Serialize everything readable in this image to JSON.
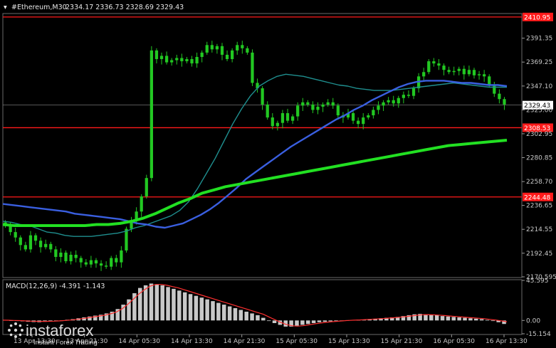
{
  "header": {
    "symbol": "#Ethereum,M30",
    "ohlc": "2334.17 2336.73 2328.69 2329.43"
  },
  "macd_header": "MACD(12,26,9) -4.391 -1.143",
  "watermark": {
    "brand": "instaforex",
    "tagline": "Instant Forex Trading"
  },
  "colors": {
    "background": "#000000",
    "candles": "#22c822",
    "ma_fast": "#1f8f8f",
    "ma_mid": "#3a5fe0",
    "ma_slow": "#22e022",
    "levels": "#ff1a1a",
    "macd_hist": "#c8c8c8",
    "macd_signal": "#ff3030"
  },
  "chart_data": [
    {
      "type": "candlestick",
      "ylim": [
        2170.595,
        2413.5
      ],
      "y_ticks": [
        "2391.35",
        "2369.25",
        "2347.10",
        "2325.00",
        "2302.95",
        "2280.85",
        "2258.70",
        "2236.65",
        "2214.55",
        "2192.45",
        "2170.595"
      ],
      "x_ticks": [
        "13 Apr 13:30",
        "13 Apr 21:30",
        "14 Apr 05:30",
        "14 Apr 13:30",
        "14 Apr 21:30",
        "15 Apr 05:30",
        "15 Apr 13:30",
        "15 Apr 21:30",
        "16 Apr 05:30",
        "16 Apr 13:30"
      ],
      "current_price": "2329.43",
      "horizontal_levels": [
        {
          "value": 2410.95,
          "label": "2410.95"
        },
        {
          "value": 2308.53,
          "label": "2308.53"
        },
        {
          "value": 2244.48,
          "label": "2244.48"
        }
      ],
      "close_series": [
        2218,
        2212,
        2207,
        2200,
        2196,
        2209,
        2204,
        2198,
        2201,
        2196,
        2189,
        2193,
        2185,
        2191,
        2188,
        2184,
        2182,
        2186,
        2183,
        2181,
        2180,
        2188,
        2184,
        2195,
        2215,
        2223,
        2231,
        2245,
        2262,
        2380,
        2372,
        2375,
        2369,
        2371,
        2373,
        2370,
        2372,
        2368,
        2374,
        2378,
        2385,
        2381,
        2384,
        2376,
        2372,
        2380,
        2385,
        2382,
        2378,
        2350,
        2345,
        2330,
        2318,
        2310,
        2313,
        2322,
        2315,
        2319,
        2329,
        2332,
        2330,
        2325,
        2328,
        2330,
        2332,
        2329,
        2320,
        2318,
        2322,
        2315,
        2312,
        2318,
        2320,
        2325,
        2329,
        2332,
        2334,
        2331,
        2336,
        2339,
        2338,
        2345,
        2356,
        2360,
        2370,
        2368,
        2366,
        2362,
        2360,
        2361,
        2363,
        2358,
        2362,
        2357,
        2358,
        2356,
        2348,
        2340,
        2335,
        2330
      ],
      "ma_fast": [
        2222,
        2221,
        2219,
        2218,
        2215,
        2212,
        2211,
        2209,
        2208,
        2208,
        2208,
        2209,
        2210,
        2211,
        2213,
        2216,
        2218,
        2221,
        2224,
        2227,
        2232,
        2240,
        2252,
        2266,
        2280,
        2296,
        2312,
        2326,
        2338,
        2347,
        2352,
        2356,
        2358,
        2357,
        2356,
        2354,
        2352,
        2350,
        2348,
        2347,
        2345,
        2344,
        2343,
        2343,
        2343,
        2344,
        2345,
        2346,
        2347,
        2348,
        2349,
        2350,
        2349,
        2348,
        2347,
        2346,
        2346,
        2346
      ],
      "ma_mid": [
        2238,
        2237,
        2236,
        2235,
        2234,
        2233,
        2232,
        2231,
        2229,
        2228,
        2227,
        2226,
        2225,
        2224,
        2222,
        2220,
        2219,
        2217,
        2216,
        2218,
        2220,
        2224,
        2228,
        2233,
        2239,
        2246,
        2253,
        2261,
        2267,
        2273,
        2279,
        2285,
        2291,
        2296,
        2301,
        2306,
        2311,
        2316,
        2320,
        2325,
        2329,
        2334,
        2338,
        2342,
        2346,
        2349,
        2351,
        2352,
        2352,
        2352,
        2351,
        2350,
        2350,
        2349,
        2348,
        2348,
        2347
      ],
      "ma_slow": [
        2219,
        2218,
        2218,
        2218,
        2218,
        2218,
        2218,
        2218,
        2219,
        2219,
        2220,
        2222,
        2225,
        2229,
        2234,
        2239,
        2243,
        2248,
        2251,
        2254,
        2256,
        2258,
        2260,
        2262,
        2264,
        2266,
        2268,
        2270,
        2272,
        2274,
        2276,
        2278,
        2280,
        2282,
        2284,
        2286,
        2288,
        2290,
        2292,
        2293,
        2294,
        2295,
        2296,
        2297
      ],
      "series": [
        {
          "name": "ma_fast"
        },
        {
          "name": "ma_mid"
        },
        {
          "name": "ma_slow"
        }
      ]
    },
    {
      "type": "bar",
      "title": "MACD(12,26,9) -4.391 -1.143",
      "ylim": [
        -15.154,
        45.595
      ],
      "y_ticks": [
        "45.595",
        "0.00",
        "-15.154"
      ],
      "histogram": [
        0.5,
        0.2,
        -0.5,
        -1,
        -1.5,
        -1.8,
        -2,
        -1.5,
        -1,
        -0.5,
        0,
        0.8,
        1.5,
        2.5,
        3.5,
        4.5,
        5.5,
        6.5,
        8,
        10,
        13,
        18,
        24,
        31,
        37,
        40,
        42,
        41,
        40,
        38,
        36,
        34,
        32,
        30,
        28,
        26,
        24,
        22,
        20,
        18,
        16,
        14,
        12,
        10,
        8,
        6,
        3,
        0,
        -3,
        -5,
        -7,
        -7,
        -6,
        -5,
        -4,
        -3,
        -2,
        -1.5,
        -1,
        -0.5,
        0,
        0.3,
        0.5,
        0.8,
        1,
        1.5,
        2,
        2.5,
        3,
        3.5,
        4,
        5,
        6,
        7,
        7.5,
        7,
        6.5,
        6,
        5,
        4.5,
        4,
        3.5,
        3,
        2.5,
        2,
        1.5,
        0.5,
        -0.5,
        -2,
        -4
      ],
      "signal": [
        0.3,
        0.2,
        0,
        -0.2,
        -0.5,
        -0.8,
        -1,
        -1.1,
        -1,
        -0.8,
        -0.5,
        0,
        0.5,
        1.2,
        2,
        3,
        4,
        5,
        6,
        7.5,
        9.5,
        13,
        18,
        24,
        30,
        35,
        39,
        41,
        41,
        40,
        38.5,
        37,
        35,
        33,
        31,
        29,
        27,
        25,
        23,
        21,
        19,
        17,
        15,
        13,
        11,
        9,
        7,
        4,
        1,
        -2,
        -4.5,
        -6,
        -6.5,
        -6,
        -5,
        -4,
        -3,
        -2.2,
        -1.5,
        -1,
        -0.5,
        0,
        0.3,
        0.6,
        1,
        1.3,
        1.7,
        2.1,
        2.6,
        3.1,
        3.6,
        4.3,
        5,
        5.8,
        6.5,
        6.6,
        6.4,
        6.1,
        5.6,
        5,
        4.5,
        4,
        3.5,
        3,
        2.5,
        2,
        1.2,
        0.5,
        -0.5,
        -1.5
      ]
    }
  ]
}
